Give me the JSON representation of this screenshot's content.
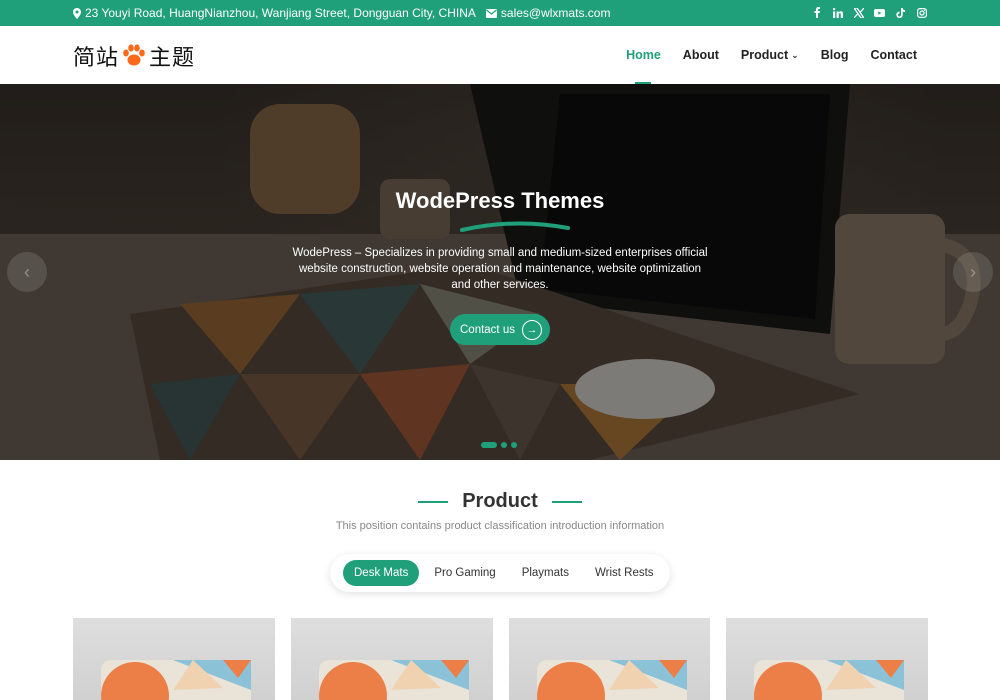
{
  "topbar": {
    "address": "23 Youyi Road, HuangNianzhou, Wanjiang Street, Dongguan City, CHINA",
    "email": "sales@wlxmats.com",
    "socials": [
      "facebook-icon",
      "linkedin-icon",
      "x-icon",
      "youtube-icon",
      "tiktok-icon",
      "instagram-icon"
    ]
  },
  "logo": {
    "text_left": "简站",
    "text_right": "主题"
  },
  "nav": {
    "items": [
      {
        "label": "Home",
        "active": true
      },
      {
        "label": "About"
      },
      {
        "label": "Product",
        "has_dropdown": true
      },
      {
        "label": "Blog"
      },
      {
        "label": "Contact"
      }
    ]
  },
  "hero": {
    "title": "WodePress Themes",
    "description": "WodePress – Specializes in providing small and medium-sized enterprises official website construction, website operation and maintenance, website optimization and other services.",
    "button_label": "Contact us",
    "slides": 3,
    "active_slide": 1
  },
  "product": {
    "title": "Product",
    "subtitle": "This position contains product classification introduction information",
    "tabs": [
      {
        "label": "Desk Mats",
        "active": true
      },
      {
        "label": "Pro Gaming"
      },
      {
        "label": "Playmats"
      },
      {
        "label": "Wrist Rests"
      }
    ],
    "card_count": 4
  },
  "colors": {
    "accent": "#20a07a",
    "topbar": "#20a07a",
    "logo_paw": "#ff6a1a"
  }
}
